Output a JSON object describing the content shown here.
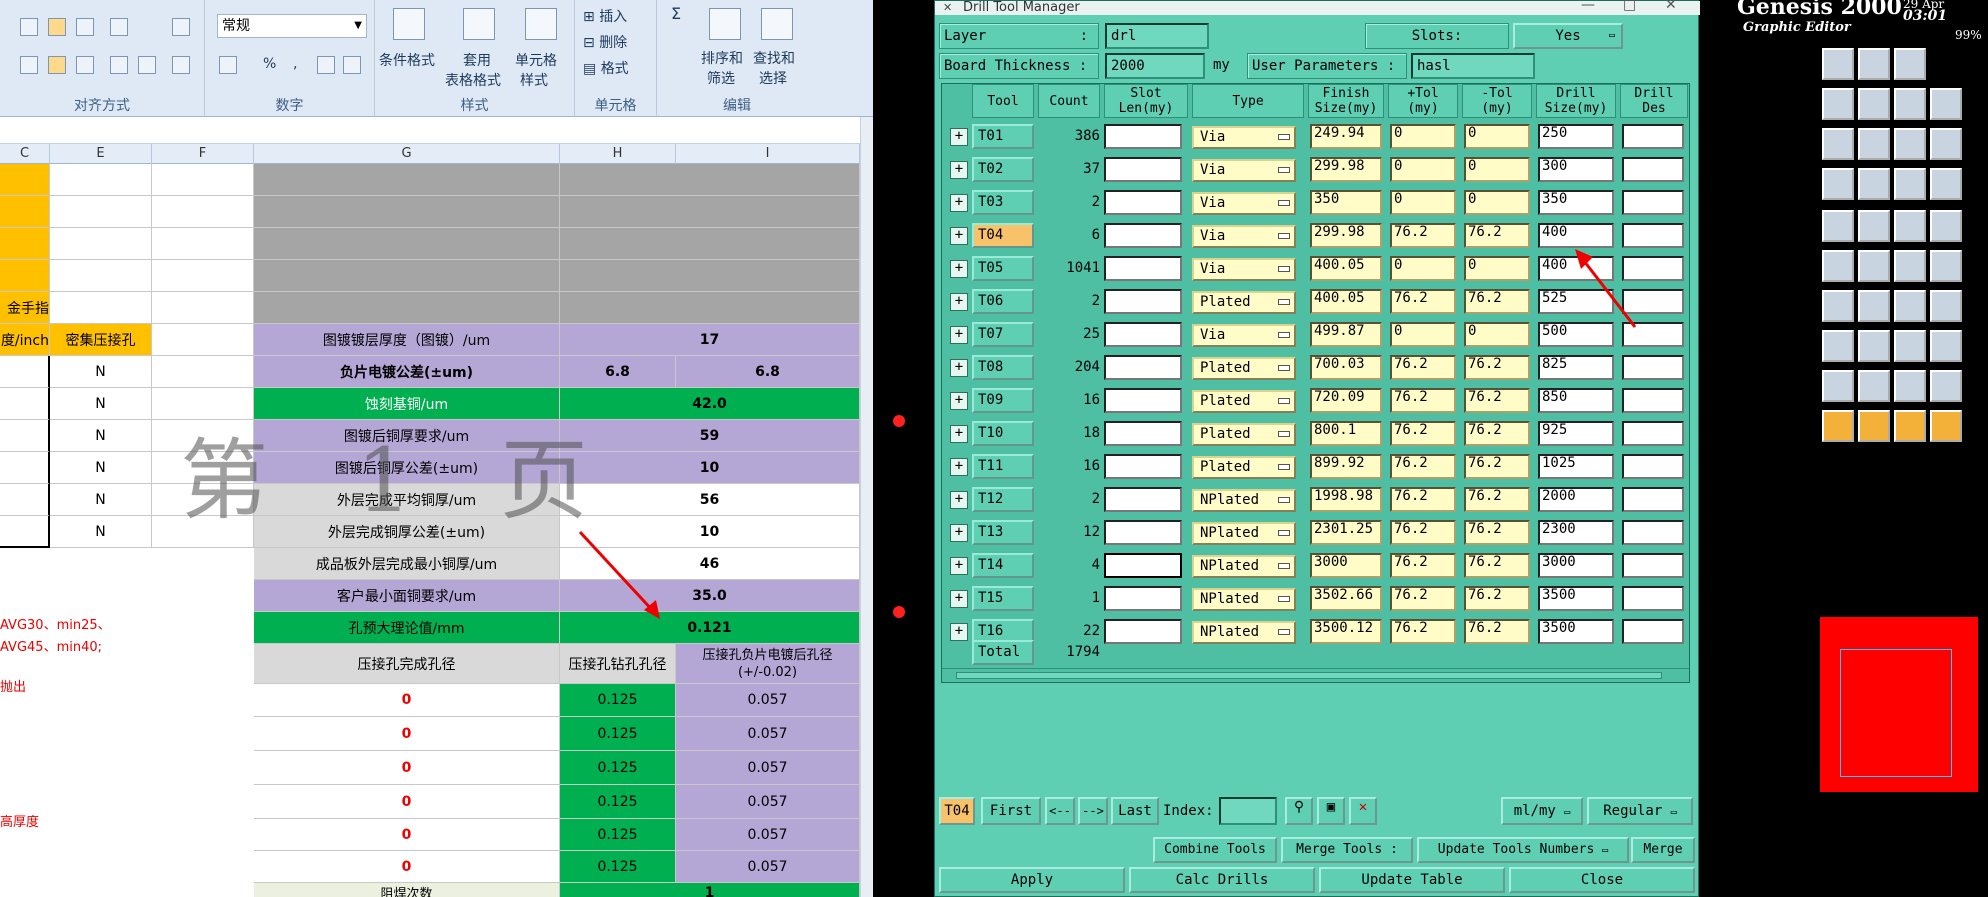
{
  "excel": {
    "ribbon": {
      "align_group": "对齐方式",
      "number_format": "常规",
      "number_group": "数字",
      "percent": "%",
      "comma": ",",
      "inc_decimal": "+.0 .00",
      "dec_decimal": ".00 +.0",
      "styles_group": "样式",
      "cond_format": "条件格式",
      "table_format_1": "套用",
      "table_format_2": "表格格式",
      "cell_style_1": "单元格",
      "cell_style_2": "样式",
      "insert": "插入",
      "delete": "删除",
      "format": "格式",
      "cells_group": "单元格",
      "sigma": "Σ",
      "sort_1": "排序和",
      "sort_2": "筛选",
      "find_1": "查找和",
      "find_2": "选择",
      "edit_group": "编辑"
    },
    "columns": [
      "C",
      "E",
      "F",
      "G",
      "H",
      "I"
    ],
    "left_fragments": {
      "gold_finger": "金手指",
      "per_inch": "度/inch",
      "press_fit": "密集压接孔",
      "n_values": [
        "N",
        "N",
        "N",
        "N",
        "N",
        "N"
      ],
      "note1": "AVG30、min25、",
      "note2": "AVG45、min40;",
      "note3": "抛出",
      "note4": "高厚度"
    },
    "rows": [
      {
        "label": "图镀镀层厚度（图镀）/um",
        "value": "17"
      },
      {
        "label": "负片电镀公差(±um)",
        "value_h": "6.8",
        "value_i": "6.8"
      },
      {
        "label": "蚀刻基铜/um",
        "value": "42.0"
      },
      {
        "label": "图镀后铜厚要求/um",
        "value": "59"
      },
      {
        "label": "图镀后铜厚公差(±um)",
        "value": "10"
      },
      {
        "label": "外层完成平均铜厚/um",
        "value": "56"
      },
      {
        "label": "外层完成铜厚公差(±um)",
        "value": "10"
      },
      {
        "label": "成品板外层完成最小铜厚/um",
        "value": "46"
      },
      {
        "label": "客户最小面铜要求/um",
        "value": "35.0"
      },
      {
        "label": "孔预大理论值/mm",
        "value": "0.121"
      }
    ],
    "press_table": {
      "col_g": "压接孔完成孔径",
      "col_h": "压接孔钻孔孔径",
      "col_i": "压接孔负片电镀后孔径(+/-0.02)",
      "rows": [
        {
          "g": "0",
          "h": "0.125",
          "i": "0.057"
        },
        {
          "g": "0",
          "h": "0.125",
          "i": "0.057"
        },
        {
          "g": "0",
          "h": "0.125",
          "i": "0.057"
        },
        {
          "g": "0",
          "h": "0.125",
          "i": "0.057"
        },
        {
          "g": "0",
          "h": "0.125",
          "i": "0.057"
        },
        {
          "g": "0",
          "h": "0.125",
          "i": "0.057"
        }
      ]
    },
    "bottom_label": "阻焊次数",
    "bottom_value": "1",
    "watermark": "第 1 页"
  },
  "genesis": {
    "title": "Genesis 2000",
    "subtitle": "Graphic Editor",
    "time": "03:01",
    "date_frag": "29 Apr",
    "zoom": "99%"
  },
  "dialog": {
    "title": "Drill Tool Manager",
    "layer_label": "Layer",
    "layer_colon": ":",
    "layer_value": "drl",
    "slots_label": "Slots:",
    "slots_value": "Yes",
    "thickness_label": "Board Thickness :",
    "thickness_value": "2000",
    "thickness_unit": "my",
    "user_params_label": "User Parameters :",
    "user_params_value": "hasl",
    "headers": {
      "tool": "Tool",
      "count": "Count",
      "slot1": "Slot",
      "slot2": "Len(my)",
      "type": "Type",
      "finish1": "Finish",
      "finish2": "Size(my)",
      "ptol1": "+Tol",
      "ptol2": "(my)",
      "mtol1": "-Tol",
      "mtol2": "(my)",
      "drill1": "Drill",
      "drill2": "Size(my)",
      "des1": "Drill",
      "des2": "Des"
    },
    "tools": [
      {
        "tool": "T01",
        "count": "386",
        "type": "Via",
        "finish": "249.94",
        "ptol": "0",
        "mtol": "0",
        "drill": "250"
      },
      {
        "tool": "T02",
        "count": "37",
        "type": "Via",
        "finish": "299.98",
        "ptol": "0",
        "mtol": "0",
        "drill": "300"
      },
      {
        "tool": "T03",
        "count": "2",
        "type": "Via",
        "finish": "350",
        "ptol": "0",
        "mtol": "0",
        "drill": "350"
      },
      {
        "tool": "T04",
        "count": "6",
        "type": "Via",
        "finish": "299.98",
        "ptol": "76.2",
        "mtol": "76.2",
        "drill": "400"
      },
      {
        "tool": "T05",
        "count": "1041",
        "type": "Via",
        "finish": "400.05",
        "ptol": "0",
        "mtol": "0",
        "drill": "400"
      },
      {
        "tool": "T06",
        "count": "2",
        "type": "Plated",
        "finish": "400.05",
        "ptol": "76.2",
        "mtol": "76.2",
        "drill": "525"
      },
      {
        "tool": "T07",
        "count": "25",
        "type": "Via",
        "finish": "499.87",
        "ptol": "0",
        "mtol": "0",
        "drill": "500"
      },
      {
        "tool": "T08",
        "count": "204",
        "type": "Plated",
        "finish": "700.03",
        "ptol": "76.2",
        "mtol": "76.2",
        "drill": "825"
      },
      {
        "tool": "T09",
        "count": "16",
        "type": "Plated",
        "finish": "720.09",
        "ptol": "76.2",
        "mtol": "76.2",
        "drill": "850"
      },
      {
        "tool": "T10",
        "count": "18",
        "type": "Plated",
        "finish": "800.1",
        "ptol": "76.2",
        "mtol": "76.2",
        "drill": "925"
      },
      {
        "tool": "T11",
        "count": "16",
        "type": "Plated",
        "finish": "899.92",
        "ptol": "76.2",
        "mtol": "76.2",
        "drill": "1025"
      },
      {
        "tool": "T12",
        "count": "2",
        "type": "NPlated",
        "finish": "1998.98",
        "ptol": "76.2",
        "mtol": "76.2",
        "drill": "2000"
      },
      {
        "tool": "T13",
        "count": "12",
        "type": "NPlated",
        "finish": "2301.25",
        "ptol": "76.2",
        "mtol": "76.2",
        "drill": "2300"
      },
      {
        "tool": "T14",
        "count": "4",
        "type": "NPlated",
        "finish": "3000",
        "ptol": "76.2",
        "mtol": "76.2",
        "drill": "3000"
      },
      {
        "tool": "T15",
        "count": "1",
        "type": "NPlated",
        "finish": "3502.66",
        "ptol": "76.2",
        "mtol": "76.2",
        "drill": "3500"
      },
      {
        "tool": "T16",
        "count": "22",
        "type": "NPlated",
        "finish": "3500.12",
        "ptol": "76.2",
        "mtol": "76.2",
        "drill": "3500"
      }
    ],
    "total_label": "Total",
    "total_count": "1794",
    "selected_tool": "T04",
    "nav": {
      "first": "First",
      "prev": "<--",
      "next": "-->",
      "last": "Last",
      "index": "Index:",
      "units": "ml/my",
      "mode": "Regular"
    },
    "actions": {
      "combine": "Combine Tools",
      "merge": "Merge Tools :",
      "update_numbers": "Update Tools Numbers",
      "merge2": "Merge",
      "apply": "Apply",
      "calc": "Calc Drills",
      "update_table": "Update Table",
      "close": "Close"
    }
  }
}
